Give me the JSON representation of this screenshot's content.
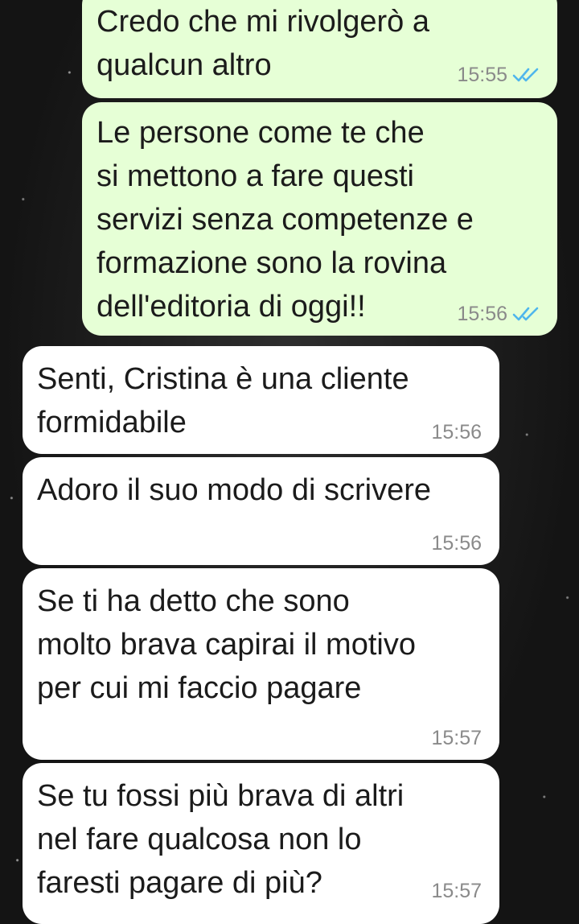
{
  "messages": [
    {
      "direction": "out",
      "text": "Credo che mi rivolgerò a\nqualcun altro",
      "time": "15:55",
      "status_icon": "double-check-read-icon"
    },
    {
      "direction": "out",
      "text": "Le persone come te che\nsi mettono a fare questi\nservizi senza competenze e\nformazione sono la rovina\ndell'editoria di oggi!!",
      "time": "15:56",
      "status_icon": "double-check-read-icon"
    },
    {
      "direction": "in",
      "text": "Senti, Cristina è una cliente\nformidabile",
      "time": "15:56"
    },
    {
      "direction": "in",
      "text": "Adoro il suo modo di scrivere",
      "time": "15:56"
    },
    {
      "direction": "in",
      "text": "Se ti ha detto che sono\nmolto brava capirai il motivo\nper cui mi faccio pagare",
      "time": "15:57"
    },
    {
      "direction": "in",
      "text": "Se tu fossi più brava di altri\nnel fare qualcosa non lo\nfaresti pagare di più?",
      "time": "15:57"
    }
  ],
  "colors": {
    "outgoing_bubble": "#e6ffd6",
    "incoming_bubble": "#ffffff",
    "read_ticks": "#4fb6ec",
    "timestamp": "#8a8a8a"
  }
}
